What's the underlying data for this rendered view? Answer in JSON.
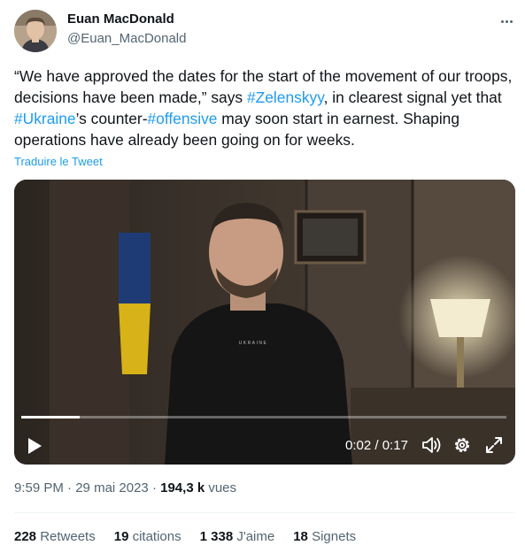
{
  "author": {
    "name": "Euan MacDonald",
    "handle": "@Euan_MacDonald"
  },
  "tweet": {
    "text_1": "“We have approved the dates for the start of the movement of our troops, decisions have been made,” says ",
    "hashtag_1": "#Zelenskyy",
    "text_2": ", in clearest signal yet that ",
    "hashtag_2": "#Ukraine",
    "text_3": "’s counter-",
    "hashtag_3": "#offensive",
    "text_4": " may soon start in earnest. Shaping operations have already been going on for weeks.",
    "translate_label": "Traduire le Tweet"
  },
  "video": {
    "shirt_text": "UKRAINE",
    "current_time": "0:02",
    "separator": " / ",
    "duration": "0:17",
    "progress_fraction": 0.12,
    "icons": [
      "play-icon",
      "volume-icon",
      "settings-gear-icon",
      "fullscreen-icon"
    ]
  },
  "meta": {
    "time": "9:59 PM",
    "dot1": " · ",
    "date": "29 mai 2023",
    "dot2": " · ",
    "views_count": "194,3 k",
    "views_label": " vues"
  },
  "stats": {
    "retweets_count": "228",
    "retweets_label": " Retweets",
    "quotes_count": "19",
    "quotes_label": " citations",
    "likes_count": "1 338",
    "likes_label": " J'aime",
    "bookmarks_count": "18",
    "bookmarks_label": " Signets"
  },
  "colors": {
    "link": "#1d9bf0",
    "secondary_text": "#536471",
    "primary_text": "#0f1419"
  }
}
